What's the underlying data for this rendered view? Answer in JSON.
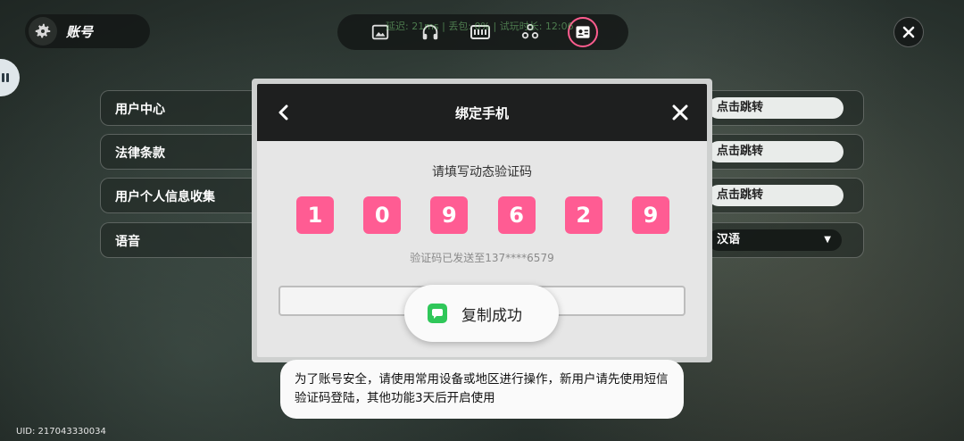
{
  "header": {
    "title": "账号",
    "net_stats": "延迟: 21ms | 丢包: 0% | 试玩时长: 12:06"
  },
  "tabs": [
    {
      "name": "image-tab",
      "icon": "image-icon"
    },
    {
      "name": "audio-tab",
      "icon": "headphones-icon"
    },
    {
      "name": "keyboard-tab",
      "icon": "keyboard-icon"
    },
    {
      "name": "controller-tab",
      "icon": "gamepad-icon"
    },
    {
      "name": "account-tab",
      "icon": "id-card-icon",
      "active": true
    }
  ],
  "settings": {
    "rows": [
      {
        "label": "用户中心",
        "action": "点击跳转"
      },
      {
        "label": "法律条款",
        "action": "点击跳转"
      },
      {
        "label": "用户个人信息收集",
        "action": "点击跳转"
      },
      {
        "label": "语音",
        "select_value": "汉语"
      }
    ]
  },
  "dialog": {
    "title": "绑定手机",
    "prompt": "请填写动态验证码",
    "code_digits": [
      "1",
      "0",
      "9",
      "6",
      "2",
      "9"
    ],
    "sent_info": "验证码已发送至137****6579",
    "input_value": ""
  },
  "toast": {
    "text": "复制成功"
  },
  "notice": {
    "text": "为了账号安全，请使用常用设备或地区进行操作，新用户请先使用短信验证码登陆，其他功能3天后开启使用"
  },
  "footer": {
    "uid": "UID: 217043330034"
  },
  "colors": {
    "accent": "#ff5c93",
    "toast_icon": "#2fc759"
  }
}
